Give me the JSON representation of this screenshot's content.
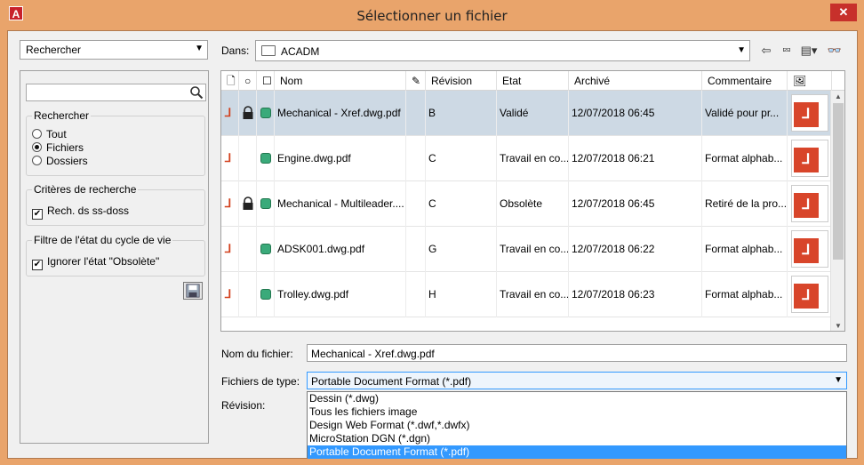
{
  "window": {
    "title": "Sélectionner un fichier",
    "app_icon": "A",
    "close": "✕"
  },
  "left": {
    "search_combo": "Rechercher",
    "search_group_title": "Rechercher",
    "options": [
      "Tout",
      "Fichiers",
      "Dossiers"
    ],
    "selected_option": "Fichiers",
    "criteria_title": "Critères de recherche",
    "criteria_check": "Rech. ds ss-doss",
    "lifecycle_title": "Filtre de l'état du cycle de vie",
    "lifecycle_check": "Ignorer l'état \"Obsolète\""
  },
  "location": {
    "label": "Dans:",
    "value": "ACADM"
  },
  "columns": [
    "Nom",
    "Révision",
    "Etat",
    "Archivé",
    "Commentaire"
  ],
  "rows": [
    {
      "name": "Mechanical - Xref.dwg.pdf",
      "revision": "B",
      "state": "Validé",
      "archived": "12/07/2018 06:45",
      "comment": "Validé pour pr...",
      "locked": true,
      "selected": true
    },
    {
      "name": "Engine.dwg.pdf",
      "revision": "C",
      "state": "Travail en co...",
      "archived": "12/07/2018 06:21",
      "comment": "Format alphab...",
      "locked": false,
      "selected": false
    },
    {
      "name": "Mechanical - Multileader....",
      "revision": "C",
      "state": "Obsolète",
      "archived": "12/07/2018 06:45",
      "comment": "Retiré de la pro...",
      "locked": true,
      "selected": false
    },
    {
      "name": "ADSK001.dwg.pdf",
      "revision": "G",
      "state": "Travail en co...",
      "archived": "12/07/2018 06:22",
      "comment": "Format alphab...",
      "locked": false,
      "selected": false
    },
    {
      "name": "Trolley.dwg.pdf",
      "revision": "H",
      "state": "Travail en co...",
      "archived": "12/07/2018 06:23",
      "comment": "Format alphab...",
      "locked": false,
      "selected": false
    }
  ],
  "bottom": {
    "filename_label": "Nom du fichier:",
    "filename_value": "Mechanical - Xref.dwg.pdf",
    "type_label": "Fichiers de type:",
    "type_value": "Portable Document Format (*.pdf)",
    "revision_label": "Révision:",
    "type_options": [
      "Dessin (*.dwg)",
      "Tous les fichiers image",
      "Design Web Format (*.dwf,*.dwfx)",
      "MicroStation DGN (*.dgn)",
      "Portable Document Format (*.pdf)"
    ],
    "type_selected_index": 4
  },
  "colors": {
    "accent": "#3399ff",
    "selected_row": "#cdd9e4",
    "frame": "#e9a46b",
    "close": "#c7302b",
    "status_green": "#3aaa7a",
    "pdf_red": "#d8452a"
  },
  "icons": [
    "autocad-app-icon",
    "search-icon",
    "folder-icon",
    "back-arrow-icon",
    "up-folder-icon",
    "views-menu-icon",
    "binoculars-icon",
    "save-icon",
    "pdf-icon",
    "lock-icon",
    "status-icon"
  ]
}
